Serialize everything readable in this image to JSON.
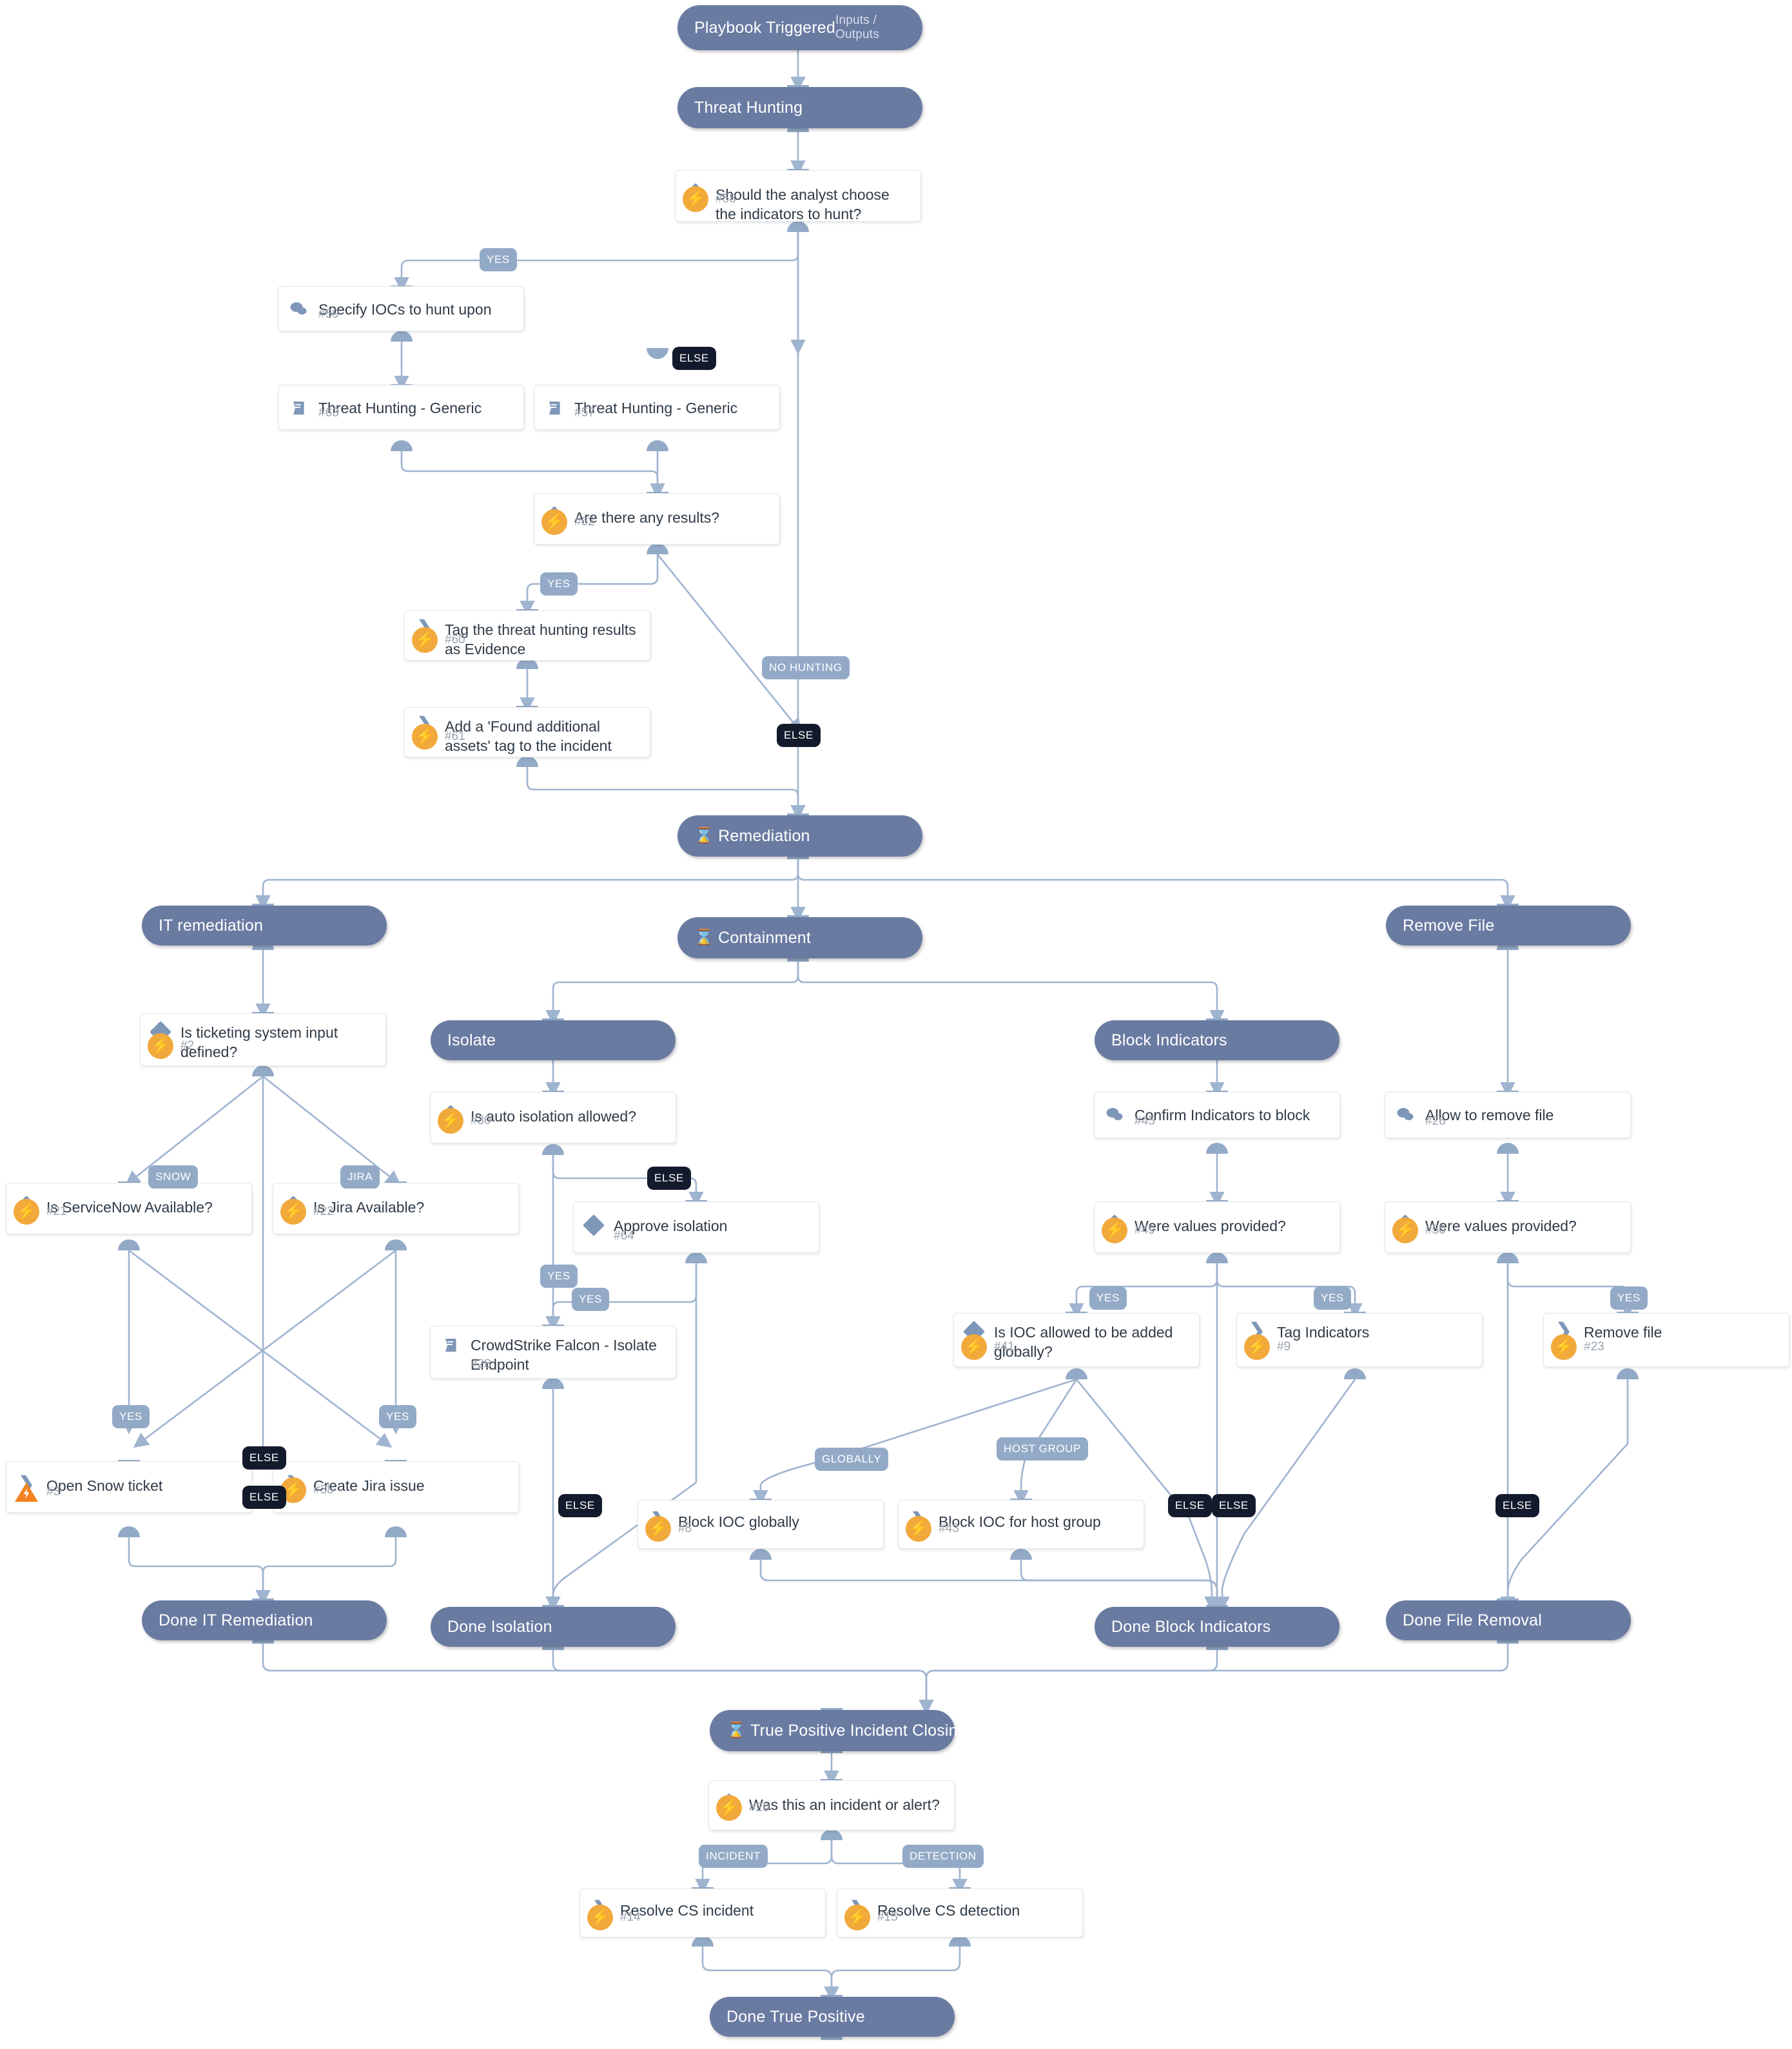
{
  "diagram": {
    "type": "playbook-workflow",
    "title": "Playbook Triggered"
  },
  "colors": {
    "section": "#6a7ba2",
    "edge": "#9fb4cf",
    "label": "#93aac7",
    "label_else": "#131a2b",
    "bolt": "#f2a93b",
    "warning": "#f5821f",
    "card_bg": "#ffffff",
    "text": "#2f3b47",
    "muted": "#9aa3ad"
  },
  "sections": [
    {
      "id": "trigger",
      "label": "Playbook Triggered",
      "io": "Inputs / Outputs",
      "timer": false
    },
    {
      "id": "threathunt",
      "label": "Threat Hunting",
      "io": "",
      "timer": false
    },
    {
      "id": "remediation",
      "label": "Remediation",
      "io": "",
      "timer": true
    },
    {
      "id": "itremed",
      "label": "IT remediation",
      "io": "",
      "timer": false
    },
    {
      "id": "containment",
      "label": "Containment",
      "io": "",
      "timer": true
    },
    {
      "id": "removefile",
      "label": "Remove File",
      "io": "",
      "timer": false
    },
    {
      "id": "isolate",
      "label": "Isolate",
      "io": "",
      "timer": false
    },
    {
      "id": "blockind",
      "label": "Block Indicators",
      "io": "",
      "timer": false
    },
    {
      "id": "doneit",
      "label": "Done IT Remediation",
      "io": "",
      "timer": false
    },
    {
      "id": "doneiso",
      "label": "Done Isolation",
      "io": "",
      "timer": false
    },
    {
      "id": "doneblock",
      "label": "Done Block Indicators",
      "io": "",
      "timer": false
    },
    {
      "id": "donefile",
      "label": "Done File Removal",
      "io": "",
      "timer": false
    },
    {
      "id": "truepos",
      "label": "True Positive Incident Closing",
      "io": "",
      "timer": true
    },
    {
      "id": "donetp",
      "label": "Done True Positive",
      "io": "",
      "timer": false
    }
  ],
  "tasks": [
    {
      "id": "t58",
      "title": "Should the analyst choose the indicators to hunt?",
      "num": "#58",
      "icon": "condition-icon",
      "badge": "bolt"
    },
    {
      "id": "t59",
      "title": "Specify IOCs to hunt upon",
      "num": "#59",
      "icon": "data-collection-icon",
      "badge": "none"
    },
    {
      "id": "t63",
      "title": "Threat Hunting - Generic",
      "num": "#63",
      "icon": "playbook-icon",
      "badge": "none"
    },
    {
      "id": "t57",
      "title": "Threat Hunting - Generic",
      "num": "#57",
      "icon": "playbook-icon",
      "badge": "none"
    },
    {
      "id": "t62",
      "title": "Are there any results?",
      "num": "#62",
      "icon": "condition-icon",
      "badge": "bolt"
    },
    {
      "id": "t60",
      "title": "Tag the threat hunting results as Evidence",
      "num": "#60",
      "icon": "command-icon",
      "badge": "bolt"
    },
    {
      "id": "t61",
      "title": "Add a 'Found additional assets' tag to the incident",
      "num": "#61",
      "icon": "command-icon",
      "badge": "bolt"
    },
    {
      "id": "t2",
      "title": "Is ticketing system input defined?",
      "num": "#2",
      "icon": "condition-icon",
      "badge": "bolt"
    },
    {
      "id": "t21",
      "title": "Is ServiceNow Available?",
      "num": "#21",
      "icon": "condition-icon",
      "badge": "bolt"
    },
    {
      "id": "t22",
      "title": "Is Jira Available?",
      "num": "#22",
      "icon": "condition-icon",
      "badge": "bolt"
    },
    {
      "id": "t3",
      "title": "Open Snow ticket",
      "num": "#3",
      "icon": "command-icon",
      "badge": "warning"
    },
    {
      "id": "t38",
      "title": "Create Jira issue",
      "num": "#38",
      "icon": "command-icon",
      "badge": "bolt"
    },
    {
      "id": "t30",
      "title": "Is auto isolation allowed?",
      "num": "#30",
      "icon": "condition-icon",
      "badge": "bolt"
    },
    {
      "id": "t64",
      "title": "Approve isolation",
      "num": "#64",
      "icon": "condition-icon",
      "badge": "none"
    },
    {
      "id": "t28",
      "title": "CrowdStrike Falcon - Isolate Endpoint",
      "num": "#28",
      "icon": "playbook-icon",
      "badge": "none"
    },
    {
      "id": "t45",
      "title": "Confirm Indicators to block",
      "num": "#45",
      "icon": "data-collection-icon",
      "badge": "none"
    },
    {
      "id": "t49",
      "title": "Were values provided?",
      "num": "#49",
      "icon": "condition-icon",
      "badge": "bolt"
    },
    {
      "id": "t41",
      "title": "Is IOC allowed to be added globally?",
      "num": "#41",
      "icon": "condition-icon",
      "badge": "bolt"
    },
    {
      "id": "t9",
      "title": "Tag Indicators",
      "num": "#9",
      "icon": "command-icon",
      "badge": "bolt"
    },
    {
      "id": "t8",
      "title": "Block IOC globally",
      "num": "#8",
      "icon": "command-icon",
      "badge": "bolt"
    },
    {
      "id": "t43",
      "title": "Block IOC for host group",
      "num": "#43",
      "icon": "command-icon",
      "badge": "bolt"
    },
    {
      "id": "t26",
      "title": "Allow to remove file",
      "num": "#26",
      "icon": "data-collection-icon",
      "badge": "none"
    },
    {
      "id": "t50",
      "title": "Were values provided?",
      "num": "#50",
      "icon": "condition-icon",
      "badge": "bolt"
    },
    {
      "id": "t23",
      "title": "Remove file",
      "num": "#23",
      "icon": "command-icon",
      "badge": "bolt"
    },
    {
      "id": "t20",
      "title": "Was this an incident or alert?",
      "num": "#20",
      "icon": "condition-icon",
      "badge": "bolt"
    },
    {
      "id": "t14",
      "title": "Resolve CS incident",
      "num": "#14",
      "icon": "command-icon",
      "badge": "bolt"
    },
    {
      "id": "t15",
      "title": "Resolve CS detection",
      "num": "#15",
      "icon": "command-icon",
      "badge": "bolt"
    }
  ],
  "edge_labels": [
    {
      "id": "L1",
      "text": "YES",
      "style": "blue"
    },
    {
      "id": "L2",
      "text": "ELSE",
      "style": "dark"
    },
    {
      "id": "L3",
      "text": "YES",
      "style": "blue"
    },
    {
      "id": "L4",
      "text": "NO HUNTING",
      "style": "blue"
    },
    {
      "id": "L5",
      "text": "ELSE",
      "style": "dark"
    },
    {
      "id": "L6",
      "text": "SNOW",
      "style": "blue"
    },
    {
      "id": "L7",
      "text": "JIRA",
      "style": "blue"
    },
    {
      "id": "L8",
      "text": "YES",
      "style": "blue"
    },
    {
      "id": "L9",
      "text": "YES",
      "style": "blue"
    },
    {
      "id": "L10",
      "text": "ELSE",
      "style": "dark"
    },
    {
      "id": "L11",
      "text": "ELSE",
      "style": "dark"
    },
    {
      "id": "L12",
      "text": "ELSE",
      "style": "dark"
    },
    {
      "id": "L13",
      "text": "YES",
      "style": "blue"
    },
    {
      "id": "L14",
      "text": "YES",
      "style": "blue"
    },
    {
      "id": "L15",
      "text": "ELSE",
      "style": "dark"
    },
    {
      "id": "L16",
      "text": "YES",
      "style": "blue"
    },
    {
      "id": "L17",
      "text": "YES",
      "style": "blue"
    },
    {
      "id": "L18",
      "text": "GLOBALLY",
      "style": "blue"
    },
    {
      "id": "L19",
      "text": "HOST GROUP",
      "style": "blue"
    },
    {
      "id": "L20",
      "text": "ELSE",
      "style": "dark"
    },
    {
      "id": "L21",
      "text": "ELSE",
      "style": "dark"
    },
    {
      "id": "L22",
      "text": "YES",
      "style": "blue"
    },
    {
      "id": "L23",
      "text": "ELSE",
      "style": "dark"
    },
    {
      "id": "L24",
      "text": "INCIDENT",
      "style": "blue"
    },
    {
      "id": "L25",
      "text": "DETECTION",
      "style": "blue"
    }
  ]
}
